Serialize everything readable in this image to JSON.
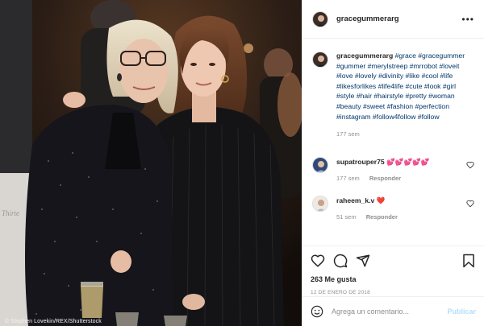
{
  "photo": {
    "credit": "© Stephen Lovekin/REX/Shutterstock"
  },
  "header": {
    "username": "gracegummerarg",
    "more_icon": "more-horizontal-icon",
    "more_glyph": "•••"
  },
  "caption": {
    "username": "gracegummerarg",
    "hashtags": "#grace #gracegummer #gummer #merylstreep #mrrobot #loveit #love #lovely #divinity #like #cool #life #likesforlikes #life4life #cute #look #girl #style #hair #hairstyle #pretty #woman #beauty #sweet #fashion #perfection #instagram #follow4follow #follow",
    "time": "177 sem"
  },
  "comments": [
    {
      "username": "supatrouper75",
      "text": "💕💕💕💕💕",
      "time": "177 sem",
      "reply_label": "Responder"
    },
    {
      "username": "raheem_k.v",
      "text": "❤️",
      "time": "51 sem",
      "reply_label": "Responder"
    }
  ],
  "actions": {
    "like_icon": "heart-icon",
    "comment_icon": "comment-icon",
    "share_icon": "share-icon",
    "save_icon": "bookmark-icon"
  },
  "likes": "263 Me gusta",
  "date": "12 DE ENERO DE 2018",
  "add_comment": {
    "placeholder": "Agrega un comentario...",
    "publish_label": "Publicar",
    "emoji_icon": "emoji-icon"
  },
  "colors": {
    "link": "#00376b",
    "muted": "#8e8e8e",
    "publish_disabled": "#b2dffc",
    "border": "#efefef"
  }
}
